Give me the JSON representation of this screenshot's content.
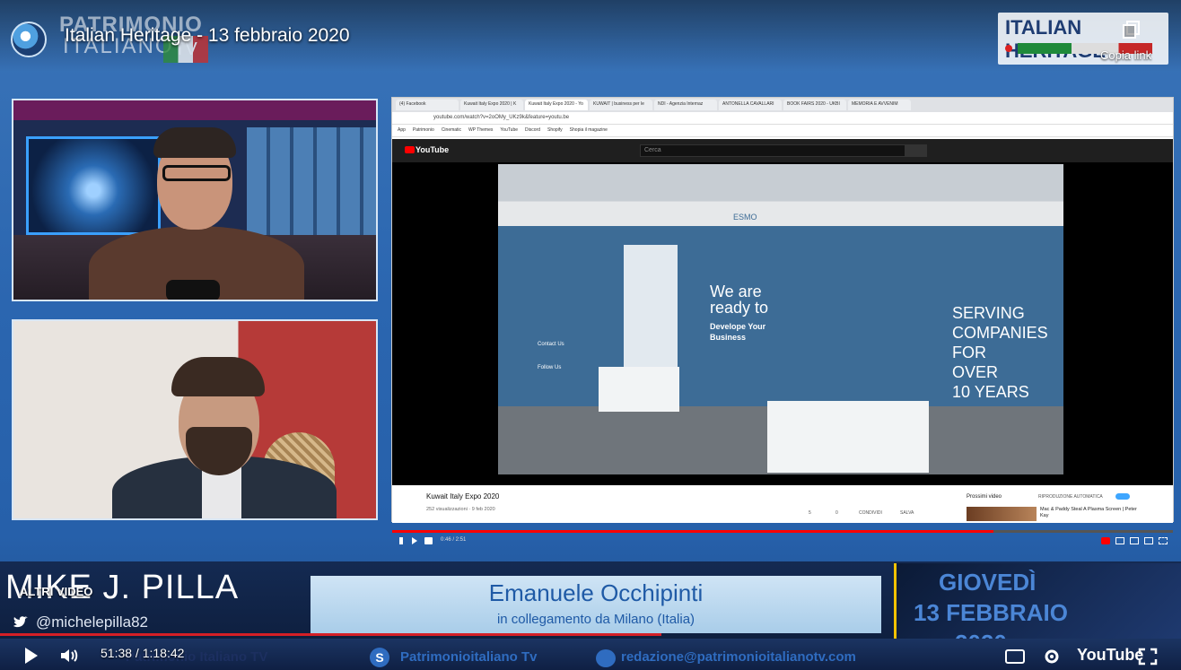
{
  "top": {
    "video_title": "Italian Heritage - 13 febbraio 2020",
    "brand_line1": "PATRIMONIO",
    "brand_line2": "ITALIANO",
    "brand_tv": "TV",
    "right_badge": "ITALIAN HERITAGE",
    "copy_link": "Copia link",
    "icons": {
      "logo": "channel-logo-icon",
      "copy": "copy-icon"
    }
  },
  "browser": {
    "tabs": [
      "(4) Facebook",
      "Kuwait Italy Expo 2020 | K",
      "Kuwait Italy Expo 2020 - Yo",
      "KUWAIT | business per le",
      "NDI - Agenzia Internaz",
      "ANTONELLA CAVALLARI",
      "BOOK FAIRS 2020 - UKBI",
      "MEMORIA E AVVENIM"
    ],
    "url": "youtube.com/watch?v=2oOMy_UKz9k&feature=youtu.be",
    "bookmarks": [
      "App",
      "Patrimonio",
      "Cinematic",
      "WP Themes",
      "YouTube",
      "Discord",
      "Shopify",
      "Shopia il magazine"
    ],
    "yt_logo": "YouTube",
    "search_placeholder": "Cerca",
    "booth": {
      "we_are": "We are",
      "ready_to": "ready to",
      "develop": "Develope Your",
      "business": "Business",
      "esmo": "ESMO",
      "serving": "SERVING",
      "companies": "COMPANIES",
      "for": "FOR",
      "over": "OVER",
      "ten_years": "10 YEARS",
      "contact": "Contact Us",
      "follow": "Follow Us"
    },
    "player": {
      "time": "0:46 / 2:51",
      "progress_pct": 77
    },
    "info": {
      "title": "Kuwait Italy Expo 2020",
      "views": "252 visualizzazioni · 9 feb 2020",
      "likes": "5",
      "dislikes": "0",
      "share": "CONDIVIDI",
      "save": "SALVA",
      "next_label": "Prossimi video",
      "autoplay_label": "RIPRODUZIONE AUTOMATICA",
      "next_title": "Mac & Paddy Steal A Plasma Screen | Peter Kay"
    }
  },
  "lower_third": {
    "host_name": "MIKE J. PILLA",
    "altri_video": "ALTRI VIDEO",
    "handle": "@michelepilla82",
    "guest_name": "Emanuele Occhipinti",
    "guest_sub": "in collegamento da Milano (Italia)",
    "date_day": "GIOVEDÌ",
    "date_date": "13 FEBBRAIO",
    "date_year": "2020",
    "footer_1": "Patrimonio Italiano TV",
    "footer_2": "Patrimonioitaliano Tv",
    "footer_3": "redazione@patrimonioitalianotv.com"
  },
  "embed_controls": {
    "time": "51:38 / 1:18:42",
    "youtube": "YouTube",
    "progress_pct": 56
  },
  "colors": {
    "accent_red": "#d51f26",
    "brand_blue": "#2f6cc0"
  }
}
